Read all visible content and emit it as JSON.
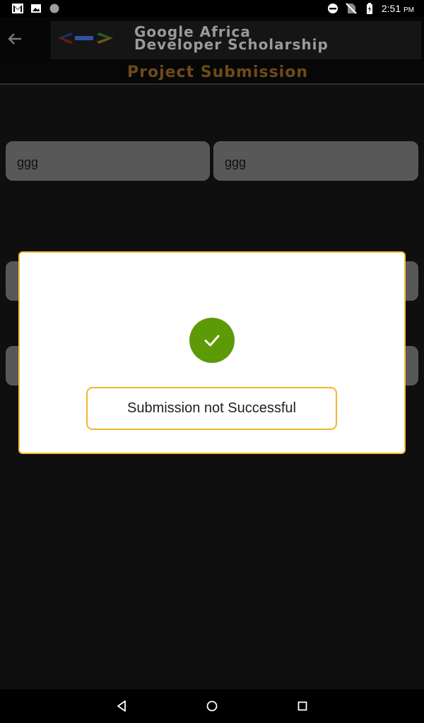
{
  "status_bar": {
    "time": "2:51",
    "time_suffix": "PM",
    "left_icons": [
      "gmail-icon",
      "image-icon",
      "circle-notification-icon"
    ],
    "right_icons": [
      "do-not-disturb-icon",
      "no-sim-icon",
      "battery-charging-icon"
    ]
  },
  "header": {
    "back_icon": "arrow-back-icon",
    "logo_icon": "developers-logo-icon",
    "banner_line1": "Google Africa",
    "banner_line2": "Developer Scholarship",
    "subtitle": "Project Submission"
  },
  "form": {
    "first_name": "ggg",
    "last_name": "ggg",
    "field3": "",
    "field4": ""
  },
  "dialog": {
    "icon": "check-icon",
    "message": "Submission not Successful",
    "colors": {
      "border": "#f6be33",
      "check_bg": "#5d9a07"
    }
  },
  "nav_bar": {
    "back": "nav-back-icon",
    "home": "nav-home-icon",
    "recents": "nav-recents-icon"
  }
}
